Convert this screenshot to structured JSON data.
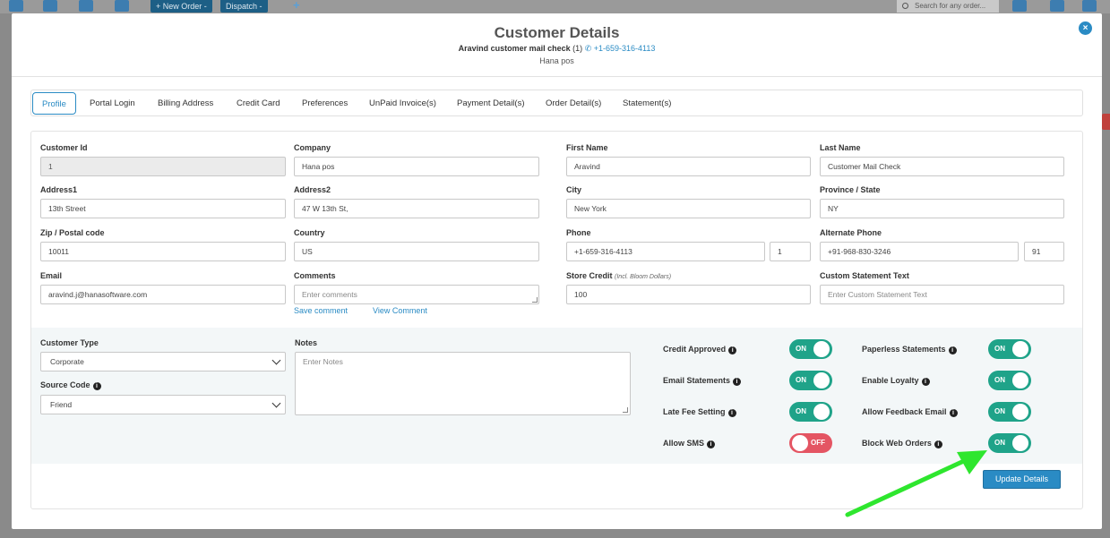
{
  "background": {
    "new_order_label": "+ New Order -",
    "dispatch_label": "Dispatch -",
    "search_placeholder": "Search for any order...",
    "add_label": "+"
  },
  "modal": {
    "title": "Customer Details",
    "customer_name": "Aravind customer mail check",
    "customer_count": "(1)",
    "customer_phone": "+1-659-316-4113",
    "company_name": "Hana pos",
    "close_icon": "×"
  },
  "tabs": [
    {
      "label": "Profile",
      "active": true
    },
    {
      "label": "Portal Login"
    },
    {
      "label": "Billing Address"
    },
    {
      "label": "Credit Card"
    },
    {
      "label": "Preferences"
    },
    {
      "label": "UnPaid Invoice(s)"
    },
    {
      "label": "Payment Detail(s)"
    },
    {
      "label": "Order Detail(s)"
    },
    {
      "label": "Statement(s)"
    }
  ],
  "form": {
    "customer_id": {
      "label": "Customer Id",
      "value": "1"
    },
    "company": {
      "label": "Company",
      "value": "Hana pos"
    },
    "first_name": {
      "label": "First Name",
      "value": "Aravind"
    },
    "last_name": {
      "label": "Last Name",
      "value": "Customer Mail Check"
    },
    "address1": {
      "label": "Address1",
      "value": "13th Street"
    },
    "address2": {
      "label": "Address2",
      "value": "47 W 13th St,"
    },
    "city": {
      "label": "City",
      "value": "New York"
    },
    "province": {
      "label": "Province / State",
      "value": "NY"
    },
    "zip": {
      "label": "Zip / Postal code",
      "value": "10011"
    },
    "country": {
      "label": "Country",
      "value": "US"
    },
    "phone": {
      "label": "Phone",
      "value": "+1-659-316-4113",
      "ext": "1"
    },
    "alt_phone": {
      "label": "Alternate Phone",
      "value": "+91-968-830-3246",
      "ext": "91"
    },
    "email": {
      "label": "Email",
      "value": "aravind.j@hanasoftware.com"
    },
    "comments": {
      "label": "Comments",
      "placeholder": "Enter comments",
      "save_link": "Save comment",
      "view_link": "View Comment"
    },
    "store_credit": {
      "label": "Store Credit",
      "note": "(Incl. Bloom Dollars)",
      "value": "100"
    },
    "custom_statement": {
      "label": "Custom Statement Text",
      "placeholder": "Enter Custom Statement Text"
    },
    "customer_type": {
      "label": "Customer Type",
      "value": "Corporate"
    },
    "source_code": {
      "label": "Source Code",
      "value": "Friend"
    },
    "notes": {
      "label": "Notes",
      "placeholder": "Enter Notes"
    }
  },
  "toggles": [
    {
      "label": "Credit Approved",
      "state": "ON"
    },
    {
      "label": "Paperless Statements",
      "state": "ON"
    },
    {
      "label": "Email Statements",
      "state": "ON"
    },
    {
      "label": "Enable Loyalty",
      "state": "ON"
    },
    {
      "label": "Late Fee Setting",
      "state": "ON"
    },
    {
      "label": "Allow Feedback Email",
      "state": "ON"
    },
    {
      "label": "Allow SMS",
      "state": "OFF"
    },
    {
      "label": "Block Web Orders",
      "state": "ON"
    }
  ],
  "update_button": "Update Details",
  "colors": {
    "accent": "#2a8bc4",
    "toggle_on": "#1fa389",
    "toggle_off": "#e45563",
    "arrow": "#2ee62e"
  },
  "icons": {
    "close": "close-icon",
    "info": "info-icon",
    "phone": "phone-icon",
    "chevron": "chevron-down-icon"
  }
}
